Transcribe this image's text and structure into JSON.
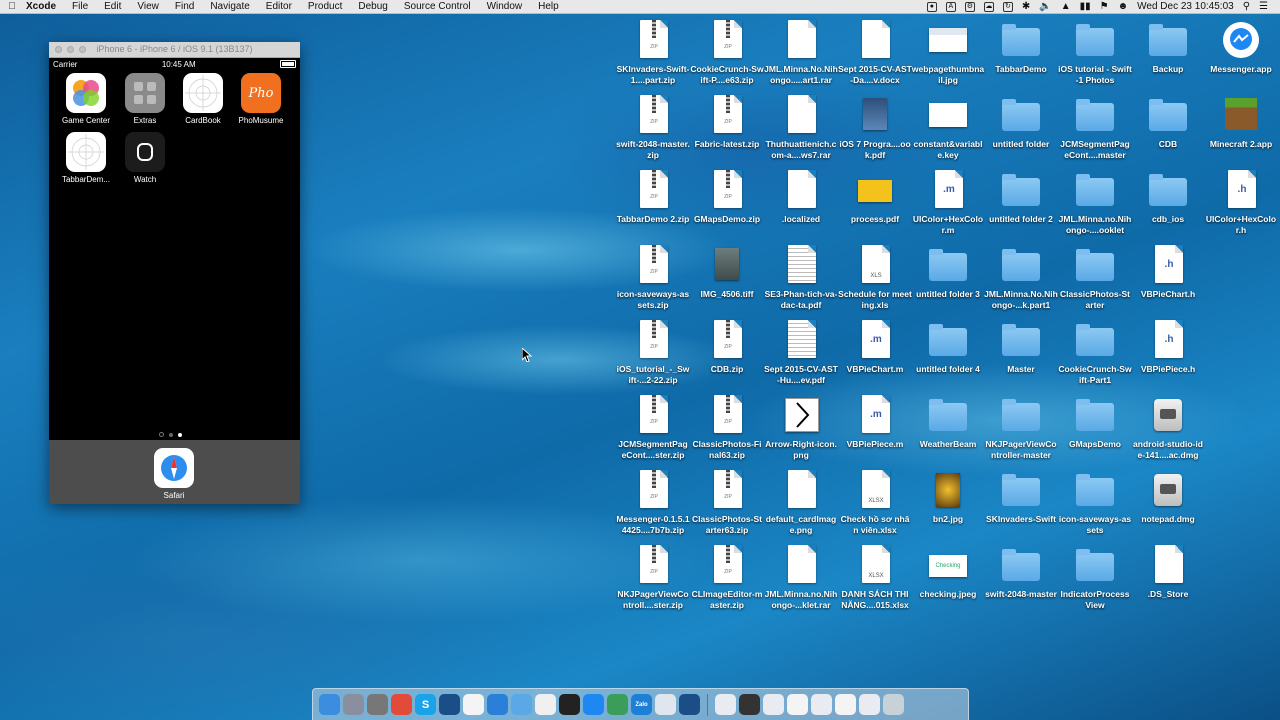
{
  "menubar": {
    "app": "Xcode",
    "items": [
      "File",
      "Edit",
      "View",
      "Find",
      "Navigate",
      "Editor",
      "Product",
      "Debug",
      "Source Control",
      "Window",
      "Help"
    ],
    "clock": "Wed Dec 23  10:45:03"
  },
  "simulator": {
    "title": "iPhone 6 - iPhone 6 / iOS 9.1 (13B137)",
    "carrier": "Carrier",
    "time": "10:45 AM",
    "apps": [
      {
        "label": "Game Center",
        "color": "#ffffff"
      },
      {
        "label": "Extras",
        "color": "#8a8a8a"
      },
      {
        "label": "CardBook",
        "color": "#ffffff"
      },
      {
        "label": "PhoMusume",
        "color": "#f07020",
        "text": "Pho"
      },
      {
        "label": "TabbarDem...",
        "color": "#ffffff"
      },
      {
        "label": "Watch",
        "color": "#1c1c1c"
      }
    ],
    "dock_app": "Safari"
  },
  "desktop": {
    "columns": [
      [
        {
          "label": "SKInvaders-Swift-1....part.zip",
          "type": "zip"
        },
        {
          "label": "swift-2048-master.zip",
          "type": "zip"
        },
        {
          "label": "TabbarDemo 2.zip",
          "type": "zip"
        },
        {
          "label": "icon-saveways-assets.zip",
          "type": "zip"
        },
        {
          "label": "iOS_tutorial_-_Swift-...2-22.zip",
          "type": "zip"
        },
        {
          "label": "JCMSegmentPageCont....ster.zip",
          "type": "zip"
        },
        {
          "label": "Messenger-0.1.5.14425....7b7b.zip",
          "type": "zip"
        },
        {
          "label": "NKJPagerViewControll....ster.zip",
          "type": "zip"
        }
      ],
      [
        {
          "label": "CookieCrunch-Swift-P....e63.zip",
          "type": "zip"
        },
        {
          "label": "Fabric-latest.zip",
          "type": "zip"
        },
        {
          "label": "GMapsDemo.zip",
          "type": "zip"
        },
        {
          "label": "IMG_4506.tiff",
          "type": "image"
        },
        {
          "label": "CDB.zip",
          "type": "zip"
        },
        {
          "label": "ClassicPhotos-Final63.zip",
          "type": "zip"
        },
        {
          "label": "ClassicPhotos-Starter63.zip",
          "type": "zip"
        },
        {
          "label": "CLImageEditor-master.zip",
          "type": "zip"
        }
      ],
      [
        {
          "label": "JML.Minna.No.Nihongo.....art1.rar",
          "type": "doc"
        },
        {
          "label": "Thuthuattienich.com-a....ws7.rar",
          "type": "doc"
        },
        {
          "label": ".localized",
          "type": "doc"
        },
        {
          "label": "SE3-Phan-tich-va-dac-ta.pdf",
          "type": "pdf"
        },
        {
          "label": "Sept 2015-CV-AST-Hu....ev.pdf",
          "type": "pdf"
        },
        {
          "label": "Arrow-Right-icon.png",
          "type": "arrow"
        },
        {
          "label": "default_cardImage.png",
          "type": "doc"
        },
        {
          "label": "JML.Minna.no.Nihongo-...klet.rar",
          "type": "doc"
        }
      ],
      [
        {
          "label": "Sept 2015-CV-AST-Da....v.docx",
          "type": "doc"
        },
        {
          "label": "iOS 7 Progra....ook.pdf",
          "type": "book"
        },
        {
          "label": "process.pdf",
          "type": "process"
        },
        {
          "label": "Schedule for meeting.xls",
          "type": "xls",
          "ext": "XLS"
        },
        {
          "label": "VBPieChart.m",
          "type": "m",
          "ext": ".m"
        },
        {
          "label": "VBPiePiece.m",
          "type": "m",
          "ext": ".m"
        },
        {
          "label": "Check hồ sơ nhân viên.xlsx",
          "type": "xls",
          "ext": "XLSX"
        },
        {
          "label": "DANH SÁCH THI NĂNG....015.xlsx",
          "type": "xls",
          "ext": "XLSX"
        }
      ],
      [
        {
          "label": "webpagethumbnail.jpg",
          "type": "web"
        },
        {
          "label": "constant&variable.key",
          "type": "key"
        },
        {
          "label": "UIColor+HexColor.m",
          "type": "m",
          "ext": ".m"
        },
        {
          "label": "untitled folder 3",
          "type": "folder"
        },
        {
          "label": "untitled folder 4",
          "type": "folder"
        },
        {
          "label": "WeatherBeam",
          "type": "folder"
        },
        {
          "label": "bn2.jpg",
          "type": "photo"
        },
        {
          "label": "checking.jpeg",
          "type": "checking",
          "text": "Checking"
        }
      ],
      [
        {
          "label": "TabbarDemo",
          "type": "folder"
        },
        {
          "label": "untitled folder",
          "type": "folder"
        },
        {
          "label": "untitled folder 2",
          "type": "folder"
        },
        {
          "label": "JML.Minna.No.Nihongo-...k.part1",
          "type": "folder"
        },
        {
          "label": "Master",
          "type": "folder"
        },
        {
          "label": "NKJPagerViewController-master",
          "type": "folder"
        },
        {
          "label": "SKInvaders-Swift",
          "type": "folder"
        },
        {
          "label": "swift-2048-master",
          "type": "folder"
        }
      ],
      [
        {
          "label": "iOS tutorial - Swift-1 Photos",
          "type": "folder"
        },
        {
          "label": "JCMSegmentPageCont....master",
          "type": "folder"
        },
        {
          "label": "JML.Minna.no.Nihongo-....ooklet",
          "type": "folder"
        },
        {
          "label": "ClassicPhotos-Starter",
          "type": "folder"
        },
        {
          "label": "CookieCrunch-Swift-Part1",
          "type": "folder"
        },
        {
          "label": "GMapsDemo",
          "type": "folder"
        },
        {
          "label": "icon-saveways-assets",
          "type": "folder"
        },
        {
          "label": "IndicatorProcessView",
          "type": "folder"
        }
      ],
      [
        {
          "label": "Backup",
          "type": "folder"
        },
        {
          "label": "CDB",
          "type": "folder"
        },
        {
          "label": "cdb_ios",
          "type": "folder"
        },
        {
          "label": "VBPieChart.h",
          "type": "h",
          "ext": ".h"
        },
        {
          "label": "VBPiePiece.h",
          "type": "h",
          "ext": ".h"
        },
        {
          "label": "android-studio-ide-141....ac.dmg",
          "type": "dmg"
        },
        {
          "label": "notepad.dmg",
          "type": "dmg"
        },
        {
          "label": ".DS_Store",
          "type": "doc"
        }
      ],
      [
        {
          "label": "Messenger.app",
          "type": "messenger"
        },
        {
          "label": "Minecraft 2.app",
          "type": "minecraft"
        },
        {
          "label": "UIColor+HexColor.h",
          "type": "h",
          "ext": ".h"
        }
      ]
    ]
  },
  "dock": {
    "items": [
      {
        "name": "finder-icon",
        "color": "#3b8de0"
      },
      {
        "name": "launchpad-icon",
        "color": "#8a8fa0"
      },
      {
        "name": "system-preferences-icon",
        "color": "#777"
      },
      {
        "name": "chrome-icon",
        "color": "#e24a3a"
      },
      {
        "name": "skype-icon",
        "color": "#1aa3e8",
        "text": "S"
      },
      {
        "name": "sourcetree-icon",
        "color": "#1b4e86"
      },
      {
        "name": "grid-app-icon",
        "color": "#f4f4f4"
      },
      {
        "name": "xcode-icon",
        "color": "#2a7fd8"
      },
      {
        "name": "folder-icon",
        "color": "#5aa9e6"
      },
      {
        "name": "itunes-icon",
        "color": "#f0f0f0"
      },
      {
        "name": "terminal-icon",
        "color": "#222"
      },
      {
        "name": "messenger-icon",
        "color": "#1e88f2"
      },
      {
        "name": "atom-icon",
        "color": "#3a9e5a"
      },
      {
        "name": "zalo-icon",
        "color": "#1e7fd6",
        "text": "Zalo"
      },
      {
        "name": "mail-icon",
        "color": "#dfe6ee"
      },
      {
        "name": "quicktime-icon",
        "color": "#1b4e86"
      },
      {
        "name": "window-thumb-1-icon",
        "color": "#e8ecf2"
      },
      {
        "name": "window-thumb-2-icon",
        "color": "#333"
      },
      {
        "name": "window-thumb-3-icon",
        "color": "#e8ecf2"
      },
      {
        "name": "window-thumb-4-icon",
        "color": "#f4f4f4"
      },
      {
        "name": "window-thumb-5-icon",
        "color": "#e8ecf2"
      },
      {
        "name": "window-thumb-6-icon",
        "color": "#f4f4f4"
      },
      {
        "name": "window-thumb-7-icon",
        "color": "#e8ecf2"
      },
      {
        "name": "trash-icon",
        "color": "#c8d0d8"
      }
    ]
  }
}
